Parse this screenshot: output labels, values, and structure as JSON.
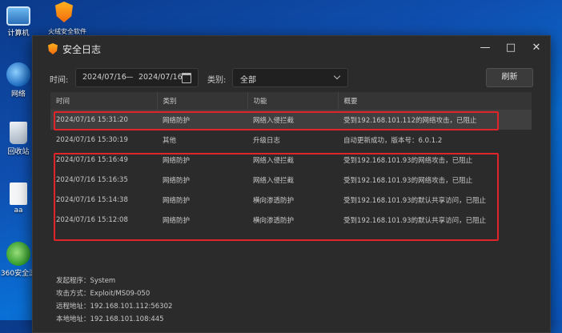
{
  "desktop": {
    "icons": [
      {
        "label": "计算机",
        "icon": "computer-icon"
      },
      {
        "label": "网络",
        "icon": "network-icon"
      },
      {
        "label": "回收站",
        "icon": "recycle-bin-icon"
      },
      {
        "label": "aa",
        "icon": "file-icon"
      },
      {
        "label": "360安全浏",
        "icon": "browser-360-icon"
      }
    ],
    "shield_shortcut_label": "火绒安全软件"
  },
  "window": {
    "title": "安全日志",
    "controls": {
      "minimize": "—",
      "maximize": "□",
      "close": "✕"
    }
  },
  "filter": {
    "time_label": "时间:",
    "date_start": "2024/07/16",
    "date_sep": "—",
    "date_end": "2024/07/16",
    "category_label": "类别:",
    "category_value": "全部",
    "refresh_label": "刷新"
  },
  "table": {
    "columns": [
      "时间",
      "类别",
      "功能",
      "概要"
    ],
    "rows": [
      [
        "2024/07/16 15:31:20",
        "网络防护",
        "网络入侵拦截",
        "受到192.168.101.112的网络攻击，已阻止"
      ],
      [
        "2024/07/16 15:30:19",
        "其他",
        "升级日志",
        "自动更新成功，版本号：6.0.1.2"
      ],
      [
        "2024/07/16 15:16:49",
        "网络防护",
        "网络入侵拦截",
        "受到192.168.101.93的网络攻击，已阻止"
      ],
      [
        "2024/07/16 15:16:35",
        "网络防护",
        "网络入侵拦截",
        "受到192.168.101.93的网络攻击，已阻止"
      ],
      [
        "2024/07/16 15:14:38",
        "网络防护",
        "横向渗透防护",
        "受到192.168.101.93的默认共享访问，已阻止"
      ],
      [
        "2024/07/16 15:12:08",
        "网络防护",
        "横向渗透防护",
        "受到192.168.101.93的默认共享访问，已阻止"
      ]
    ],
    "selected_row": 0
  },
  "details": {
    "lines": [
      "发起程序：System",
      "攻击方式：Exploit/MS09-050",
      "远程地址：192.168.101.112:56302",
      "本地地址：192.168.101.108:445"
    ]
  },
  "colors": {
    "highlight": "#e0242a",
    "window_bg": "#2b2b2b",
    "accent": "#f26b0f"
  }
}
